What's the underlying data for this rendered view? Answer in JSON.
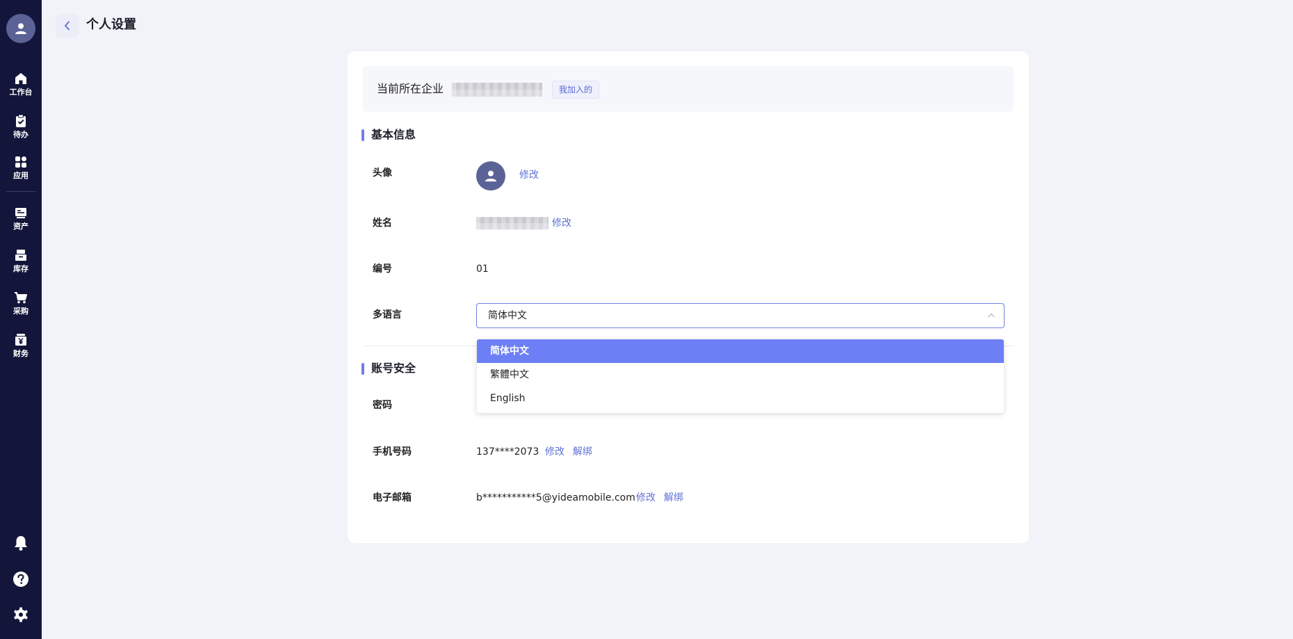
{
  "sidebar": {
    "items": [
      {
        "label": "工作台",
        "icon": "home-icon"
      },
      {
        "label": "待办",
        "icon": "clipboard-check-icon"
      },
      {
        "label": "应用",
        "icon": "grid-icon"
      },
      {
        "label": "资产",
        "icon": "asset-icon"
      },
      {
        "label": "库存",
        "icon": "inventory-icon"
      },
      {
        "label": "采购",
        "icon": "cart-icon"
      },
      {
        "label": "财务",
        "icon": "finance-icon"
      }
    ],
    "bottom_icons": [
      "bell-icon",
      "help-icon",
      "settings-icon"
    ]
  },
  "header": {
    "title": "个人设置"
  },
  "company": {
    "label": "当前所在企业",
    "badge": "我加入的"
  },
  "basic_info": {
    "title": "基本信息",
    "avatar_label": "头像",
    "avatar_edit": "修改",
    "name_label": "姓名",
    "name_edit": "修改",
    "number_label": "编号",
    "number_value": "01",
    "language_label": "多语言",
    "language_value": "简体中文"
  },
  "language_options": [
    "简体中文",
    "繁體中文",
    "English"
  ],
  "security": {
    "title": "账号安全",
    "password_label": "密码",
    "phone_label": "手机号码",
    "phone_value": "137****2073",
    "phone_edit": "修改",
    "phone_unbind": "解绑",
    "email_label": "电子邮箱",
    "email_value": "b***********5@yideamobile.com",
    "email_edit": "修改",
    "email_unbind": "解绑"
  },
  "colors": {
    "sidebar_bg": "#13163a",
    "accent": "#6d7ff4",
    "link": "#6072d6",
    "page_bg": "#f2f3f8"
  }
}
